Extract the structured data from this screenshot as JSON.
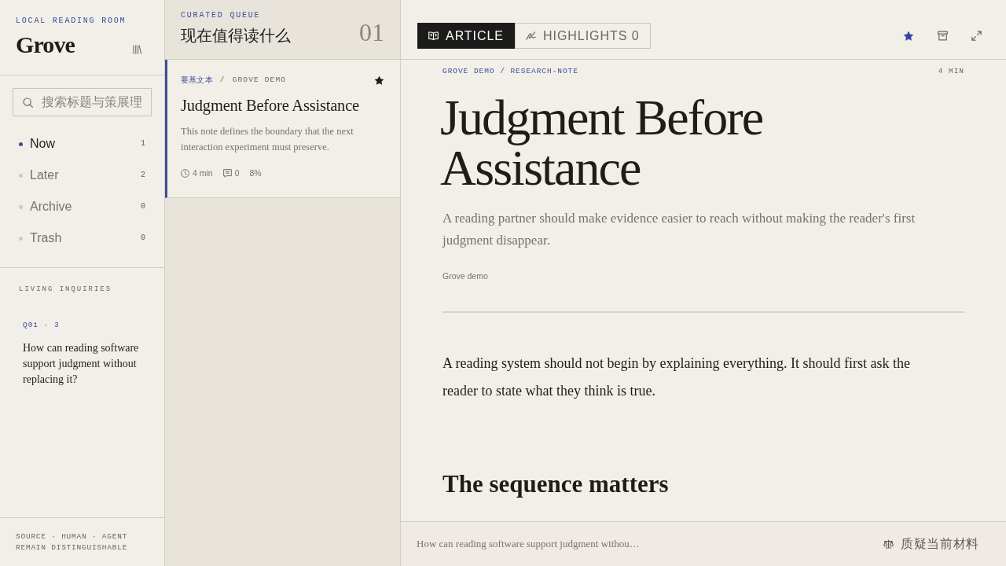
{
  "sidebar": {
    "eyebrow": "LOCAL READING ROOM",
    "brand": "Grove",
    "search": {
      "placeholder": "搜索标题与策展理"
    },
    "nav": [
      {
        "label": "Now",
        "count": "1",
        "selected": true
      },
      {
        "label": "Later",
        "count": "2",
        "selected": false
      },
      {
        "label": "Archive",
        "count": "0",
        "selected": false
      },
      {
        "label": "Trash",
        "count": "0",
        "selected": false
      }
    ],
    "inquiries": {
      "heading": "LIVING INQUIRIES",
      "items": [
        {
          "tag": "Q01 · 3",
          "question": "How can reading software support judgment without replacing it?"
        }
      ]
    },
    "footer": "SOURCE · HUMAN · AGENT REMAIN DISTINGUISHABLE"
  },
  "queue": {
    "eyebrow": "CURATED QUEUE",
    "title": "现在值得读什么",
    "count": "01",
    "items": [
      {
        "tag": "要基文本",
        "separator": "/",
        "source": "GROVE DEMO",
        "starred": true,
        "selected": true,
        "title": "Judgment Before Assistance",
        "summary": "This note defines the boundary that the next interaction experiment must preserve.",
        "read_time": "4 min",
        "comments": "0",
        "progress": "8%"
      }
    ]
  },
  "reader": {
    "tabs": [
      {
        "kind": "article",
        "label": "ARTICLE",
        "selected": true
      },
      {
        "kind": "highlights",
        "label": "HIGHLIGHTS 0",
        "selected": false
      }
    ],
    "starred": true,
    "article": {
      "breadcrumb": "GROVE DEMO / RESEARCH-NOTE",
      "read_time": "4 MIN",
      "title": "Judgment Before Assistance",
      "dek": "A reading partner should make evidence easier to reach without making the reader's first judgment disappear.",
      "byline": "Grove demo",
      "body": [
        {
          "kind": "paragraph",
          "text": "A reading system should not begin by explaining everything. It should first ask the reader to state what they think is true."
        },
        {
          "kind": "heading",
          "text": "The sequence matters"
        }
      ]
    },
    "footer": {
      "excerpt": "How can reading software support judgment withou…",
      "action": "质疑当前材料"
    }
  }
}
